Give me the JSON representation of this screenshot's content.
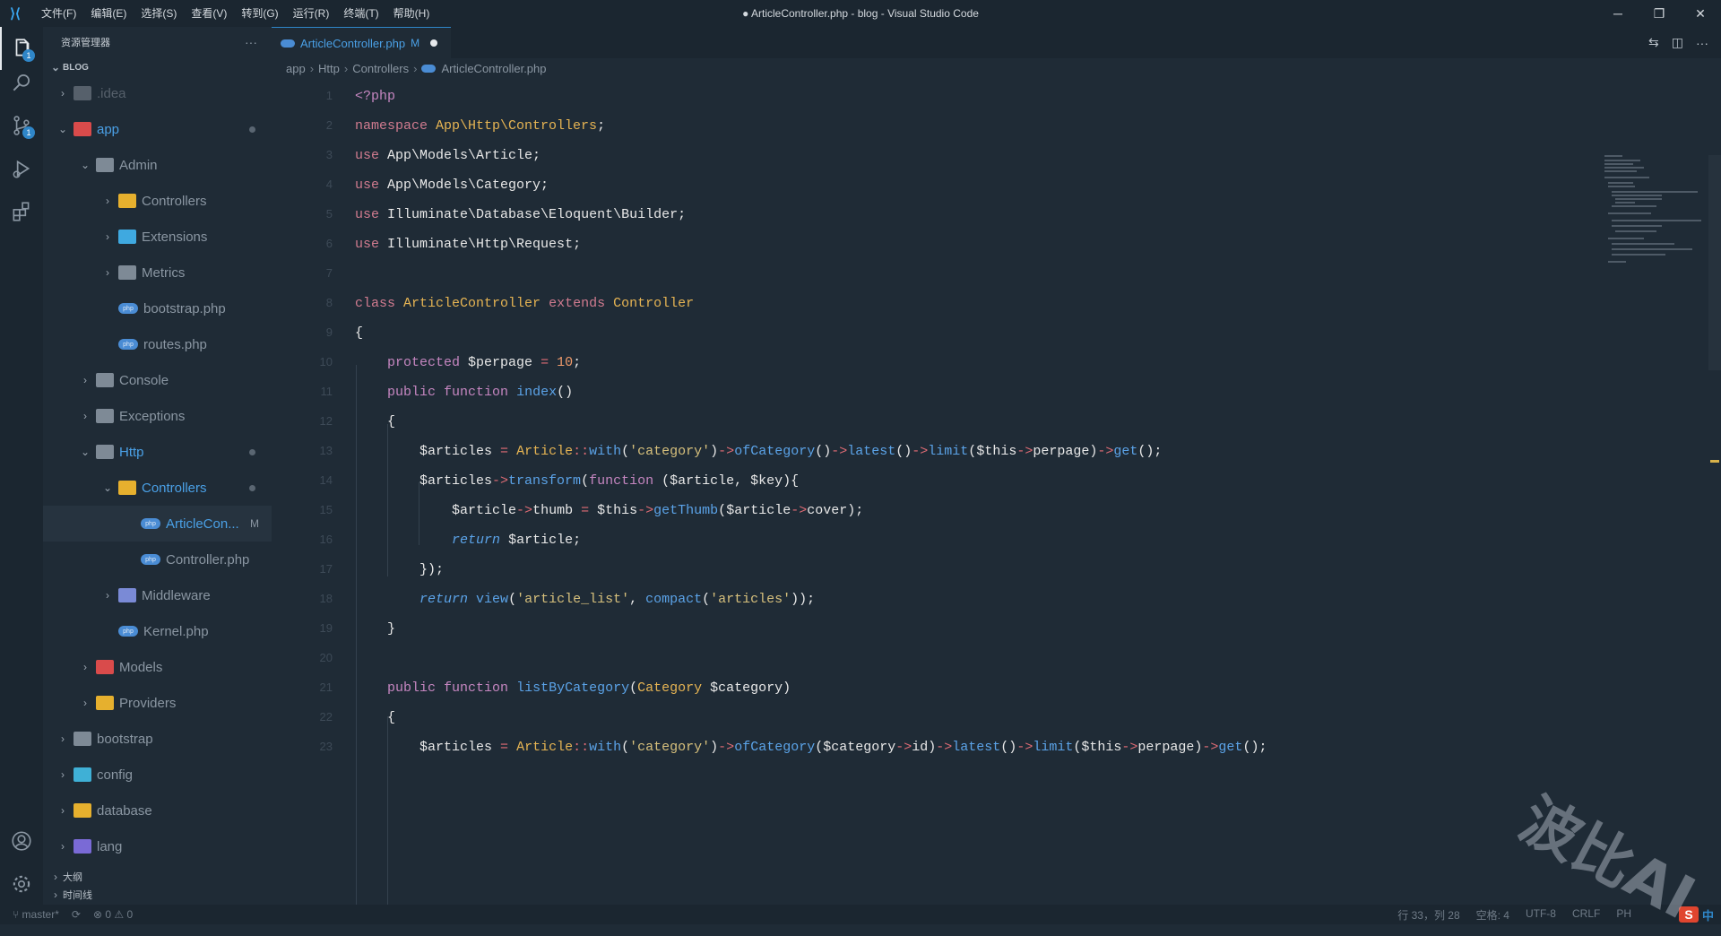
{
  "titlebar": {
    "menu": [
      "文件(F)",
      "编辑(E)",
      "选择(S)",
      "查看(V)",
      "转到(G)",
      "运行(R)",
      "终端(T)",
      "帮助(H)"
    ],
    "title": "● ArticleController.php - blog - Visual Studio Code"
  },
  "activity": {
    "explorer_badge": "1",
    "scm_badge": "1"
  },
  "sidebar": {
    "title": "资源管理器",
    "root": "BLOG",
    "items": [
      {
        "label": ".idea",
        "color": "#56606b"
      },
      {
        "label": "app",
        "color": "#4aa0e6"
      },
      {
        "label": "Admin",
        "color": "#8a96a2"
      },
      {
        "label": "Controllers",
        "color": "#8a96a2"
      },
      {
        "label": "Extensions",
        "color": "#8a96a2"
      },
      {
        "label": "Metrics",
        "color": "#8a96a2"
      },
      {
        "label": "bootstrap.php",
        "color": "#8a96a2"
      },
      {
        "label": "routes.php",
        "color": "#8a96a2"
      },
      {
        "label": "Console",
        "color": "#8a96a2"
      },
      {
        "label": "Exceptions",
        "color": "#8a96a2"
      },
      {
        "label": "Http",
        "color": "#4aa0e6"
      },
      {
        "label": "Controllers",
        "color": "#4aa0e6"
      },
      {
        "label": "ArticleCon...",
        "color": "#4aa0e6",
        "badge": "M"
      },
      {
        "label": "Controller.php",
        "color": "#8a96a2"
      },
      {
        "label": "Middleware",
        "color": "#8a96a2"
      },
      {
        "label": "Kernel.php",
        "color": "#8a96a2"
      },
      {
        "label": "Models",
        "color": "#8a96a2"
      },
      {
        "label": "Providers",
        "color": "#8a96a2"
      },
      {
        "label": "bootstrap",
        "color": "#8a96a2"
      },
      {
        "label": "config",
        "color": "#8a96a2"
      },
      {
        "label": "database",
        "color": "#8a96a2"
      },
      {
        "label": "lang",
        "color": "#8a96a2"
      }
    ],
    "outline": "大纲",
    "timeline": "时间线"
  },
  "tab": {
    "label": "ArticleController.php",
    "badge": "M"
  },
  "breadcrumb": [
    "app",
    "Http",
    "Controllers",
    "ArticleController.php"
  ],
  "editor": {
    "line_numbers": [
      "1",
      "2",
      "3",
      "4",
      "5",
      "6",
      "7",
      "8",
      "9",
      "10",
      "11",
      "12",
      "13",
      "14",
      "15",
      "16",
      "17",
      "18",
      "19",
      "20",
      "21",
      "22",
      "23"
    ]
  },
  "status": {
    "branch": "master*",
    "problems": "⊗ 0 ⚠ 0",
    "position": "行 33，列 28",
    "spaces": "空格: 4",
    "encoding": "UTF-8",
    "eol": "CRLF",
    "lang": "PH"
  },
  "ime": {
    "s": "S",
    "zh": "中"
  },
  "watermark": "波比AI"
}
